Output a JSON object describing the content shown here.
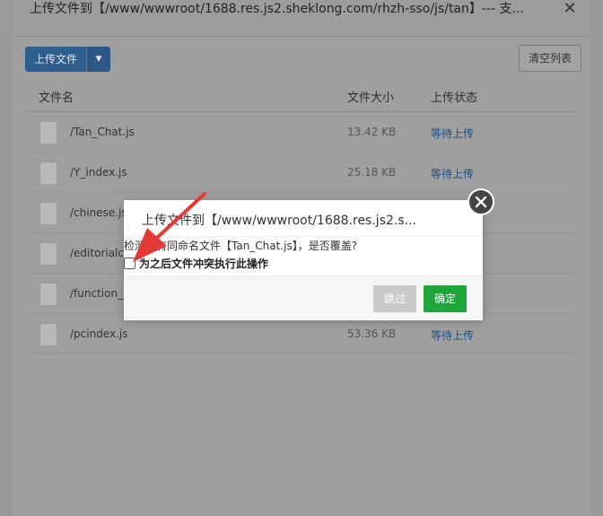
{
  "window": {
    "title": "上传文件到【/www/wwwroot/1688.res.js2.sheklong.com/rhzh-sso/js/tan】--- 支...",
    "close_glyph": "✕"
  },
  "toolbar": {
    "upload_label": "上传文件",
    "clear_label": "清空列表"
  },
  "table": {
    "headers": {
      "name": "文件名",
      "size": "文件大小",
      "status": "上传状态"
    },
    "rows": [
      {
        "name": "/Tan_Chat.js",
        "size": "13.42 KB",
        "status": "等待上传"
      },
      {
        "name": "/Y_index.js",
        "size": "25.18 KB",
        "status": "等待上传"
      },
      {
        "name": "/chinese.js",
        "size": "",
        "status": ""
      },
      {
        "name": "/editorialc",
        "size": "",
        "status": ""
      },
      {
        "name": "/function_",
        "size": "",
        "status": ""
      },
      {
        "name": "/pcindex.js",
        "size": "53.36 KB",
        "status": "等待上传"
      }
    ]
  },
  "dialog": {
    "title": "上传文件到【/www/wwwroot/1688.res.js2.s...",
    "message": "检测到有同命名文件【Tan_Chat.js】，是否覆盖?",
    "checkbox_label": "为之后文件冲突执行此操作",
    "skip_label": "跳过",
    "confirm_label": "确定"
  },
  "colors": {
    "confirm": "#20a53a",
    "link_status": "#1e4e84",
    "annotation_arrow": "#e53935"
  },
  "icons": [
    "file-icon",
    "caret-down-icon",
    "close-icon",
    "annotation-arrow"
  ]
}
